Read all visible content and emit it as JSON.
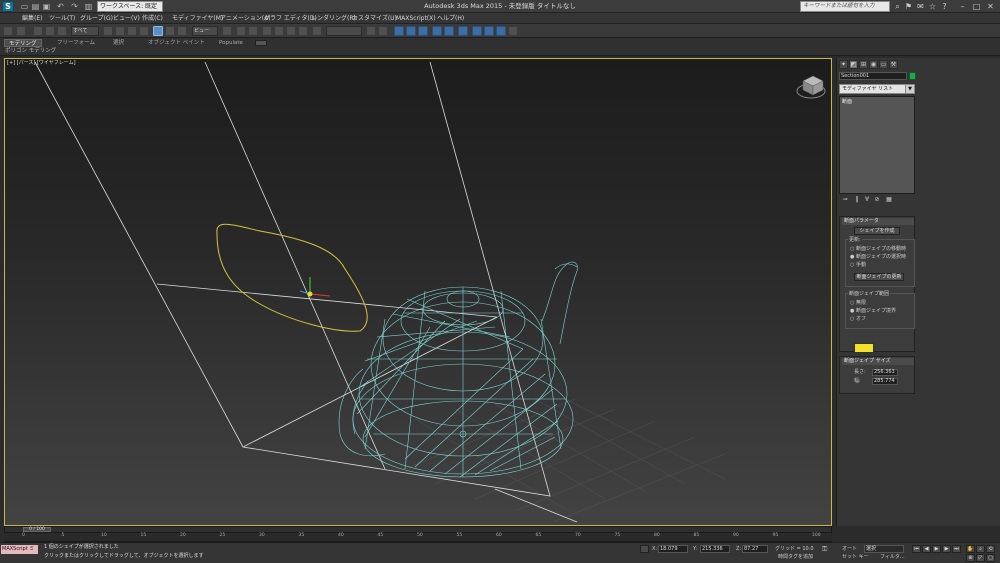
{
  "titlebar": {
    "logo": "S",
    "workspace": "ワークスペース: 既定値",
    "title": "Autodesk 3ds Max 2015 - 未登録版  タイトルなし",
    "search_placeholder": "キーワードまたは語句を入力"
  },
  "menu": [
    "編集(E)",
    "ツール(T)",
    "グループ(G)",
    "ビュー(V)",
    "作成(C)",
    "モディファイヤ(M)",
    "アニメーション(A)",
    "グラフ エディタ(D)",
    "レンダリング(R)",
    "カスタマイズ(U)",
    "MAXScript(X)",
    "ヘルプ(H)"
  ],
  "toolbar": {
    "selection_filter": "すべて",
    "ref_coord": "ビュー"
  },
  "ribbon": {
    "tabs": [
      "モデリング",
      "フリーフォーム",
      "選択",
      "オブジェクト ペイント",
      "Populate"
    ],
    "active_tab": 0,
    "sub_label": "ポリゴン モデリング"
  },
  "viewport": {
    "label": "[+] [パース] [ワイヤフレーム]"
  },
  "command_panel": {
    "object_name": "Section001",
    "object_color": "#1fa84a",
    "modifier_list": "モディファイヤ リスト",
    "stack_item": "断面",
    "rollout1": {
      "title": "断面パラメータ",
      "create_shape": "シェイプを作成",
      "update_group": "更新:",
      "update_options": [
        "断面ジェイプの移動時",
        "断面ジェイプの選択時",
        "手動"
      ],
      "update_selected": 1,
      "update_button": "断面ジェイプの更新",
      "extent_group": "断面ジェイプ範囲",
      "extent_options": [
        "無限",
        "断面ジェイプ境界",
        "オフ"
      ],
      "extent_selected": 1,
      "swatch_color": "#f2e22c"
    },
    "rollout2": {
      "title": "断面ジェイプ サイズ",
      "length_label": "長さ:",
      "length_value": "256.363",
      "width_label": "幅:",
      "width_value": "285.774"
    }
  },
  "timeline": {
    "slider": "0 / 100",
    "ticks": [
      "0",
      "5",
      "10",
      "15",
      "20",
      "25",
      "30",
      "35",
      "40",
      "45",
      "50",
      "55",
      "60",
      "65",
      "70",
      "75",
      "80",
      "85",
      "90",
      "95",
      "100"
    ]
  },
  "status": {
    "maxscript": "MAXScript ミ",
    "line1": "1 個のシェイプが選択されました",
    "line2": "クリックまたはクリックしてドラッグして、オブジェクトを選択します",
    "x_label": "X:",
    "x_value": "18.079",
    "y_label": "Y:",
    "y_value": "215.336",
    "z_label": "Z:",
    "z_value": "87.27",
    "grid": "グリッド = 10.0",
    "add_time_tag": "時間タグを追加",
    "auto": "オート",
    "set_key": "セット キー",
    "selected": "選択",
    "filter": "フィルタ..."
  }
}
